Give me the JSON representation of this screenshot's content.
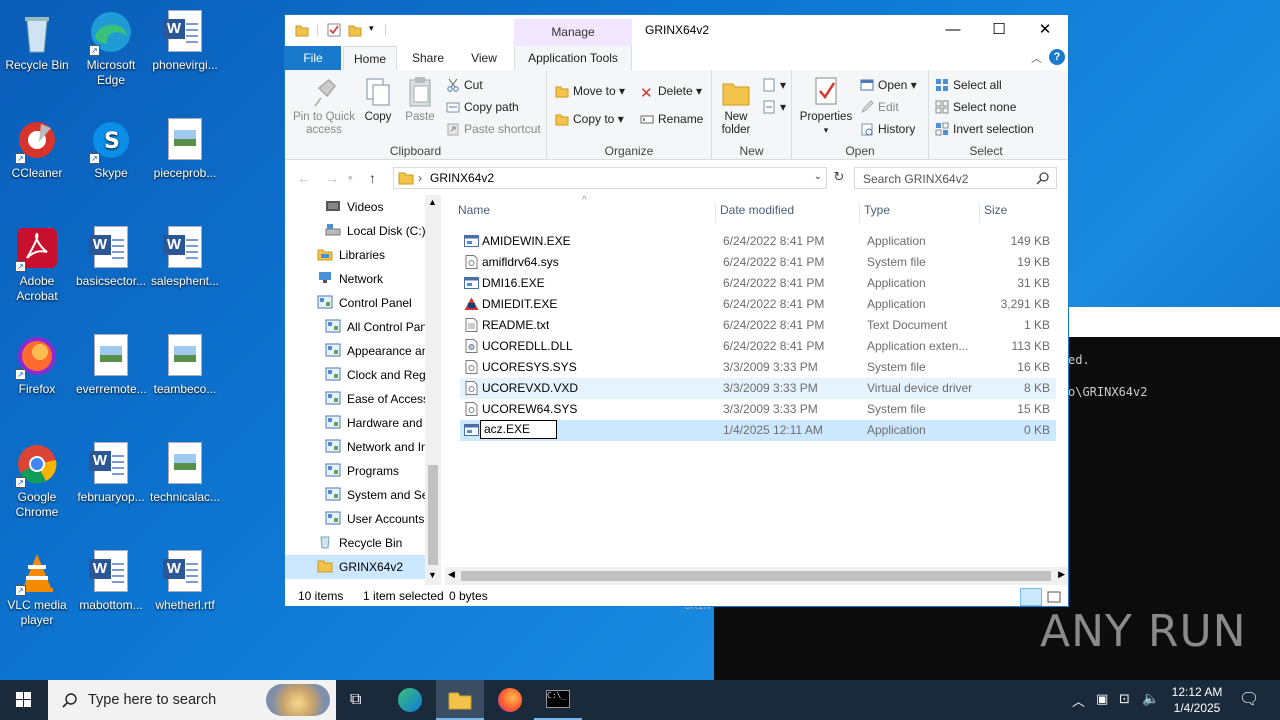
{
  "desktop": {
    "icons": [
      {
        "label": "Recycle Bin",
        "kind": "recycle"
      },
      {
        "label": "Microsoft Edge",
        "kind": "edge"
      },
      {
        "label": "phonevirgi...",
        "kind": "word"
      },
      {
        "label": "CCleaner",
        "kind": "ccleaner"
      },
      {
        "label": "Skype",
        "kind": "skype"
      },
      {
        "label": "pieceprob...",
        "kind": "image"
      },
      {
        "label": "Adobe Acrobat",
        "kind": "acrobat"
      },
      {
        "label": "basicsector...",
        "kind": "word"
      },
      {
        "label": "salesphent...",
        "kind": "word"
      },
      {
        "label": "Firefox",
        "kind": "firefox"
      },
      {
        "label": "everremote...",
        "kind": "image"
      },
      {
        "label": "teambeco...",
        "kind": "image"
      },
      {
        "label": "Google Chrome",
        "kind": "chrome"
      },
      {
        "label": "februaryop...",
        "kind": "word"
      },
      {
        "label": "technicalac...",
        "kind": "image"
      },
      {
        "label": "VLC media player",
        "kind": "vlc"
      },
      {
        "label": "mabottom...",
        "kind": "word"
      },
      {
        "label": "whetherl.rtf",
        "kind": "word"
      }
    ]
  },
  "terminal": {
    "line1": "ed.",
    "line2": "o\\GRINX64v2",
    "stray": "GRIN"
  },
  "watermark": "ANY RUN",
  "explorer": {
    "title": "GRINX64v2",
    "manage_label": "Manage",
    "window_controls": {
      "minimize": "—",
      "maximize": "☐",
      "close": "✕"
    },
    "tabs": {
      "file": "File",
      "home": "Home",
      "share": "Share",
      "view": "View",
      "app_tools": "Application Tools"
    },
    "ribbon": {
      "clipboard": {
        "label": "Clipboard",
        "pin": "Pin to Quick access",
        "copy": "Copy",
        "paste": "Paste",
        "cut": "Cut",
        "copy_path": "Copy path",
        "paste_shortcut": "Paste shortcut"
      },
      "organize": {
        "label": "Organize",
        "move_to": "Move to",
        "copy_to": "Copy to",
        "delete": "Delete",
        "rename": "Rename"
      },
      "new": {
        "label": "New",
        "new_folder": "New folder"
      },
      "open": {
        "label": "Open",
        "properties": "Properties",
        "open": "Open",
        "edit": "Edit",
        "history": "History"
      },
      "select": {
        "label": "Select",
        "select_all": "Select all",
        "select_none": "Select none",
        "invert": "Invert selection"
      }
    },
    "address": {
      "crumb": "GRINX64v2",
      "search_placeholder": "Search GRINX64v2"
    },
    "nav": [
      {
        "label": "Videos",
        "indent": 1
      },
      {
        "label": "Local Disk (C:)",
        "indent": 1
      },
      {
        "label": "Libraries",
        "indent": 0
      },
      {
        "label": "Network",
        "indent": 0
      },
      {
        "label": "Control Panel",
        "indent": 0
      },
      {
        "label": "All Control Panel Items",
        "indent": 1
      },
      {
        "label": "Appearance and Personalization",
        "indent": 1
      },
      {
        "label": "Clock and Region",
        "indent": 1
      },
      {
        "label": "Ease of Access",
        "indent": 1
      },
      {
        "label": "Hardware and Sound",
        "indent": 1
      },
      {
        "label": "Network and Internet",
        "indent": 1
      },
      {
        "label": "Programs",
        "indent": 1
      },
      {
        "label": "System and Security",
        "indent": 1
      },
      {
        "label": "User Accounts",
        "indent": 1
      },
      {
        "label": "Recycle Bin",
        "indent": 0
      },
      {
        "label": "GRINX64v2",
        "indent": 0
      }
    ],
    "columns": {
      "name": "Name",
      "date": "Date modified",
      "type": "Type",
      "size": "Size"
    },
    "files": [
      {
        "name": "AMIDEWIN.EXE",
        "date": "6/24/2022 8:41 PM",
        "type": "Application",
        "size": "149 KB",
        "icon": "exe"
      },
      {
        "name": "amifldrv64.sys",
        "date": "6/24/2022 8:41 PM",
        "type": "System file",
        "size": "19 KB",
        "icon": "sys"
      },
      {
        "name": "DMI16.EXE",
        "date": "6/24/2022 8:41 PM",
        "type": "Application",
        "size": "31 KB",
        "icon": "exe"
      },
      {
        "name": "DMIEDIT.EXE",
        "date": "6/24/2022 8:41 PM",
        "type": "Application",
        "size": "3,291 KB",
        "icon": "dmiedit"
      },
      {
        "name": "README.txt",
        "date": "6/24/2022 8:41 PM",
        "type": "Text Document",
        "size": "1 KB",
        "icon": "txt"
      },
      {
        "name": "UCOREDLL.DLL",
        "date": "6/24/2022 8:41 PM",
        "type": "Application exten...",
        "size": "113 KB",
        "icon": "dll"
      },
      {
        "name": "UCORESYS.SYS",
        "date": "3/3/2009 3:33 PM",
        "type": "System file",
        "size": "16 KB",
        "icon": "sys"
      },
      {
        "name": "UCOREVXD.VXD",
        "date": "3/3/2009 3:33 PM",
        "type": "Virtual device driver",
        "size": "8 KB",
        "icon": "sys"
      },
      {
        "name": "UCOREW64.SYS",
        "date": "3/3/2009 3:33 PM",
        "type": "System file",
        "size": "15 KB",
        "icon": "sys"
      },
      {
        "name": "acz.EXE",
        "date": "1/4/2025 12:11 AM",
        "type": "Application",
        "size": "0 KB",
        "icon": "exe"
      }
    ],
    "status": {
      "items": "10 items",
      "selected": "1 item selected",
      "size": "0 bytes"
    }
  },
  "taskbar": {
    "search_placeholder": "Type here to search",
    "time": "12:12 AM",
    "date": "1/4/2025"
  },
  "colors": {
    "accent": "#1979ca",
    "selection": "#cce8ff",
    "hover": "#e5f3ff",
    "manage_tab": "#f3e6ff"
  }
}
